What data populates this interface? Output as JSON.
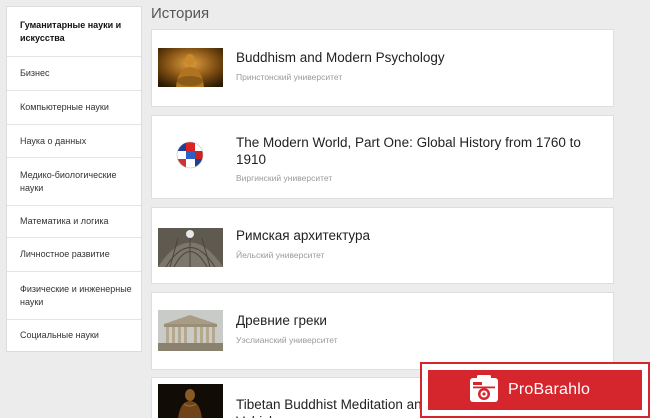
{
  "sidebar": {
    "items": [
      {
        "label": "Гуманитарные науки и искусства",
        "active": true
      },
      {
        "label": "Бизнес"
      },
      {
        "label": "Компьютерные науки"
      },
      {
        "label": "Наука о данных"
      },
      {
        "label": "Медико-биологические науки"
      },
      {
        "label": "Математика и логика"
      },
      {
        "label": "Личностное развитие"
      },
      {
        "label": "Физические и инженерные науки"
      },
      {
        "label": "Социальные науки"
      }
    ]
  },
  "section": {
    "title": "История"
  },
  "courses": [
    {
      "title": "Buddhism and Modern Psychology",
      "university": "Принстонский университет",
      "thumb": "buddha-statue-thumbnail"
    },
    {
      "title": "The Modern World, Part One: Global History from 1760 to 1910",
      "university": "Виргинский университет",
      "thumb": "flag-globe-thumbnail"
    },
    {
      "title": "Римская архитектура",
      "university": "Йельский университет",
      "thumb": "pantheon-dome-thumbnail"
    },
    {
      "title": "Древние греки",
      "university": "Уэслианский университет",
      "thumb": "parthenon-thumbnail"
    },
    {
      "title": "Tibetan Buddhist Meditation and the Modern World: Lesser Vehicle",
      "university": "",
      "thumb": "tibetan-buddha-thumbnail"
    }
  ],
  "ad": {
    "brand": "ProBarahlo",
    "accent": "#d6262d"
  }
}
